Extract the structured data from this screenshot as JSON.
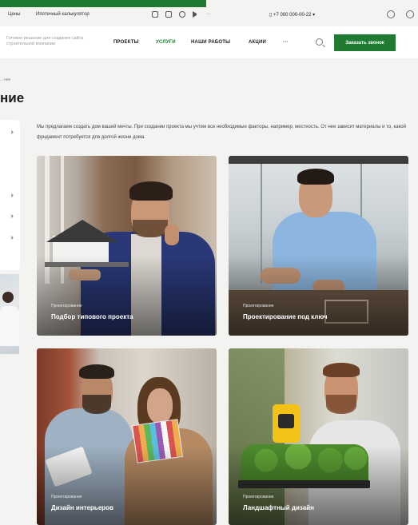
{
  "topbar": {
    "prices": "Цены",
    "calculator": "Ипотечный калькулятор",
    "icons": [
      "vk-icon",
      "ok-icon",
      "instagram-icon",
      "telegram-icon",
      "more-icon"
    ],
    "phone": "+7 000 000-00-22",
    "right_icons": [
      "favorites-icon",
      "cart-icon"
    ]
  },
  "header": {
    "tagline": "Готовое решение для создания сайта строительной компании",
    "nav": [
      "ПРОЕКТЫ",
      "УСЛУГИ",
      "НАШИ РАБОТЫ",
      "АКЦИИ",
      "···"
    ],
    "active_nav": "УСЛУГИ",
    "cta": "Заказать звонок"
  },
  "breadcrumb": "…ние",
  "page_title": "ние",
  "intro": "Мы предлагаем создать дом вашей мечты. При создании проекта мы учтем все необходимые факторы, например, местность. От нее зависят материалы и то, какой фундамент потребуется для долгой жизни дома.",
  "cards": [
    {
      "category": "Проектирование",
      "title": "Подбор типового проекта"
    },
    {
      "category": "Проектирование",
      "title": "Проектирование под ключ"
    },
    {
      "category": "Проектирование",
      "title": "Дизайн интерьеров"
    },
    {
      "category": "Проектирование",
      "title": "Ландшафтный дизайн"
    }
  ],
  "colors": {
    "brand_green": "#1f7a32",
    "page_bg": "#f3f3f2"
  }
}
